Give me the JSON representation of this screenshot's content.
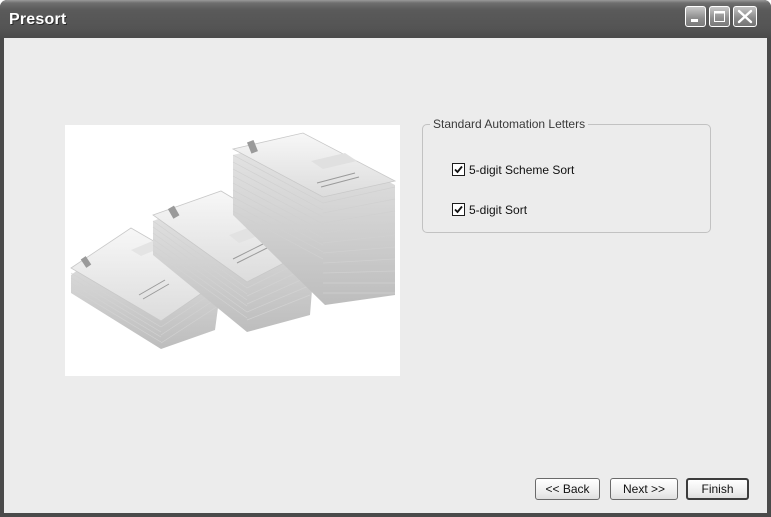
{
  "window": {
    "title": "Presort"
  },
  "group": {
    "legend": "Standard Automation Letters",
    "options": [
      {
        "label": "5-digit Scheme Sort",
        "checked": true
      },
      {
        "label": "5-digit Sort",
        "checked": true
      }
    ]
  },
  "buttons": {
    "back": "<< Back",
    "next": "Next >>",
    "finish": "Finish"
  },
  "image": {
    "subject": "stacks of envelopes"
  }
}
